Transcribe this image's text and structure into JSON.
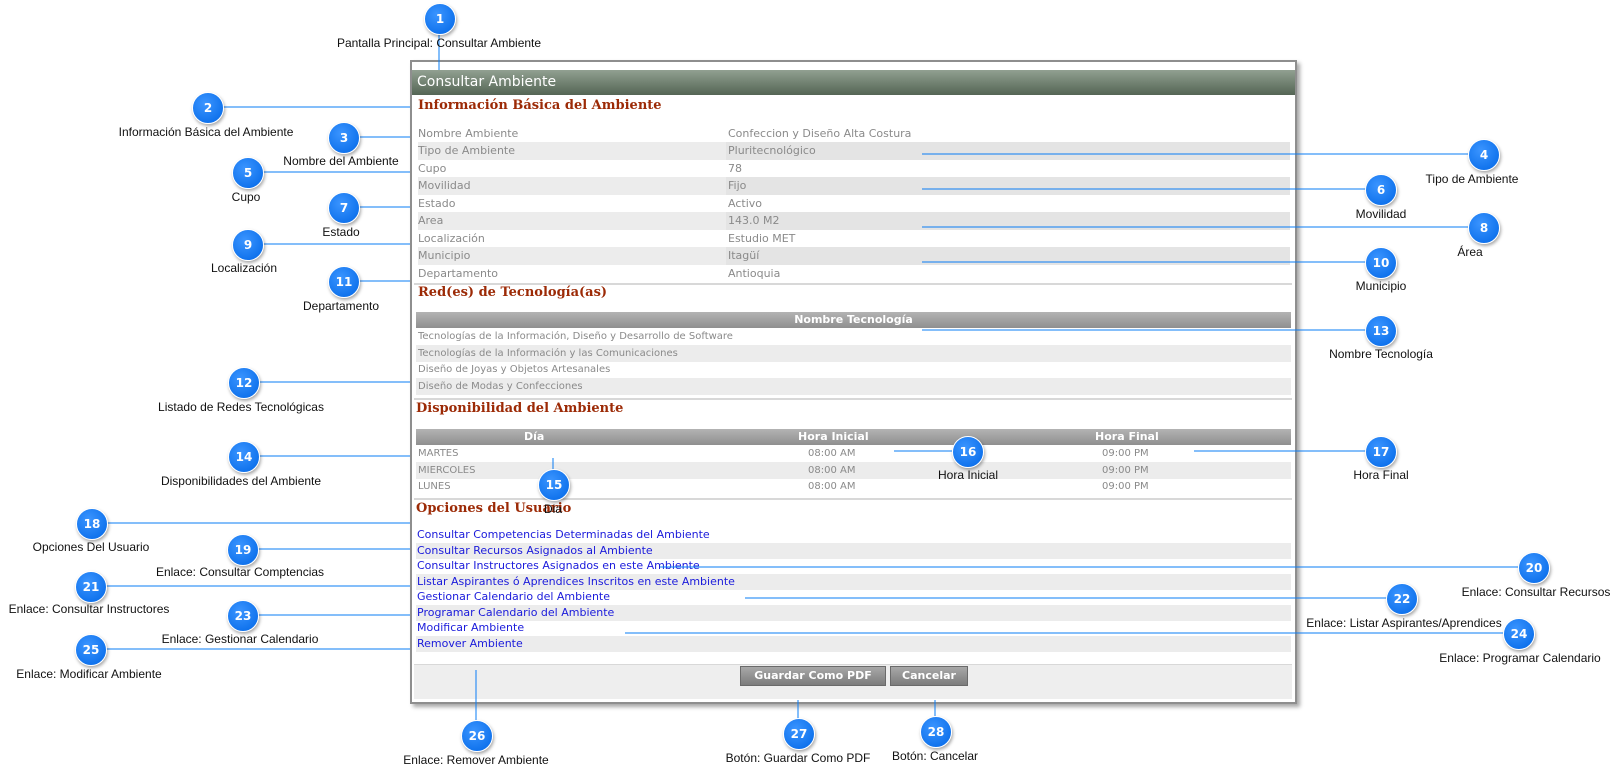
{
  "window": {
    "title": "Consultar Ambiente",
    "sections": {
      "basic": "Información Básica del Ambiente",
      "networks": "Red(es) de Tecnología(as)",
      "availability": "Disponibilidad del Ambiente",
      "options": "Opciones del Usuario"
    },
    "fields": [
      {
        "label": "Nombre Ambiente",
        "value": "Confeccion y Diseño Alta Costura"
      },
      {
        "label": "Tipo de Ambiente",
        "value": "Pluritecnológico"
      },
      {
        "label": "Cupo",
        "value": "78"
      },
      {
        "label": "Movilidad",
        "value": "Fijo"
      },
      {
        "label": "Estado",
        "value": "Activo"
      },
      {
        "label": "Area",
        "value": "143.0 M2"
      },
      {
        "label": "Localización",
        "value": "Estudio MET"
      },
      {
        "label": "Municipio",
        "value": "Itagüí"
      },
      {
        "label": "Departamento",
        "value": "Antioquia"
      }
    ],
    "tech_table": {
      "header": "Nombre Tecnología",
      "rows": [
        "Tecnologías de la Información, Diseño y Desarrollo de Software",
        "Tecnologías de la Información y las Comunicaciones",
        "Diseño de Joyas y Objetos Artesanales",
        "Diseño de Modas y Confecciones"
      ]
    },
    "availability_table": {
      "headers": {
        "day": "Día",
        "start": "Hora Inicial",
        "end": "Hora Final"
      },
      "rows": [
        {
          "day": "MARTES",
          "start": "08:00 AM",
          "end": "09:00 PM"
        },
        {
          "day": "MIERCOLES",
          "start": "08:00 AM",
          "end": "09:00 PM"
        },
        {
          "day": "LUNES",
          "start": "08:00 AM",
          "end": "09:00 PM"
        }
      ]
    },
    "links": [
      "Consultar Competencias Determinadas del Ambiente",
      "Consultar Recursos Asignados al Ambiente",
      "Consultar Instructores Asignados en este Ambiente",
      "Listar Aspirantes ó Aprendices Inscritos en este Ambiente",
      "Gestionar Calendario del Ambiente",
      "Programar Calendario del Ambiente",
      "Modificar Ambiente",
      "Remover Ambiente"
    ],
    "buttons": {
      "pdf": "Guardar Como PDF",
      "cancel": "Cancelar"
    }
  },
  "callouts": [
    {
      "n": "1",
      "label": "Pantalla Principal: Consultar Ambiente"
    },
    {
      "n": "2",
      "label": "Información Básica del Ambiente"
    },
    {
      "n": "3",
      "label": "Nombre del Ambiente"
    },
    {
      "n": "4",
      "label": "Tipo de Ambiente"
    },
    {
      "n": "5",
      "label": "Cupo"
    },
    {
      "n": "6",
      "label": "Movilidad"
    },
    {
      "n": "7",
      "label": "Estado"
    },
    {
      "n": "8",
      "label": "Área"
    },
    {
      "n": "9",
      "label": "Localización"
    },
    {
      "n": "10",
      "label": "Municipio"
    },
    {
      "n": "11",
      "label": "Departamento"
    },
    {
      "n": "12",
      "label": "Listado de Redes Tecnológicas"
    },
    {
      "n": "13",
      "label": "Nombre Tecnología"
    },
    {
      "n": "14",
      "label": "Disponibilidades del Ambiente"
    },
    {
      "n": "15",
      "label": "Dia"
    },
    {
      "n": "16",
      "label": "Hora Inicial"
    },
    {
      "n": "17",
      "label": "Hora Final"
    },
    {
      "n": "18",
      "label": "Opciones Del Usuario"
    },
    {
      "n": "19",
      "label": "Enlace: Consultar Comptencias"
    },
    {
      "n": "20",
      "label": "Enlace: Consultar Recursos"
    },
    {
      "n": "21",
      "label": "Enlace: Consultar Instructores"
    },
    {
      "n": "22",
      "label": "Enlace: Listar Aspirantes/Aprendices"
    },
    {
      "n": "23",
      "label": "Enlace: Gestionar Calendario"
    },
    {
      "n": "24",
      "label": "Enlace: Programar Calendario"
    },
    {
      "n": "25",
      "label": "Enlace: Modificar Ambiente"
    },
    {
      "n": "26",
      "label": "Enlace: Remover Ambiente"
    },
    {
      "n": "27",
      "label": "Botón: Guardar Como PDF"
    },
    {
      "n": "28",
      "label": "Botón: Cancelar"
    }
  ],
  "colors": {
    "accent": "#0a7cf5",
    "section": "#9c2a06",
    "link": "#1a1adb"
  }
}
